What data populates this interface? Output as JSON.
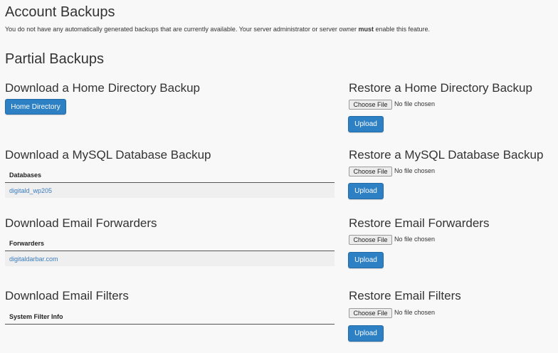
{
  "account_backups": {
    "title": "Account Backups",
    "notice_pre": "You do not have any automatically generated backups that are currently available. Your server administrator or server owner ",
    "notice_bold": "must",
    "notice_post": " enable this feature."
  },
  "partial_backups": {
    "title": "Partial Backups"
  },
  "home_backup": {
    "title": "Download a Home Directory Backup",
    "button": "Home Directory"
  },
  "home_restore": {
    "title": "Restore a Home Directory Backup",
    "choose": "Choose File",
    "status": "No file chosen",
    "upload": "Upload"
  },
  "mysql_backup": {
    "title": "Download a MySQL Database Backup",
    "header": "Databases",
    "rows": [
      "digitald_wp205"
    ]
  },
  "mysql_restore": {
    "title": "Restore a MySQL Database Backup",
    "choose": "Choose File",
    "status": "No file chosen",
    "upload": "Upload"
  },
  "forwarders_backup": {
    "title": "Download Email Forwarders",
    "header": "Forwarders",
    "rows": [
      "digitaldarbar.com"
    ]
  },
  "forwarders_restore": {
    "title": "Restore Email Forwarders",
    "choose": "Choose File",
    "status": "No file chosen",
    "upload": "Upload"
  },
  "filters_backup": {
    "title": "Download Email Filters",
    "header": "System Filter Info"
  },
  "filters_restore": {
    "title": "Restore Email Filters",
    "choose": "Choose File",
    "status": "No file chosen",
    "upload": "Upload"
  }
}
